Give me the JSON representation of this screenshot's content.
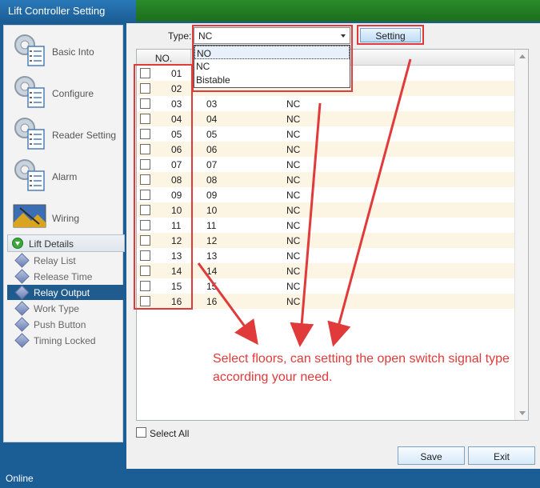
{
  "window": {
    "title": "Lift Controller Setting"
  },
  "sidebar": {
    "items": [
      {
        "label": "Basic Into",
        "icon": "gear-checklist-icon"
      },
      {
        "label": "Configure",
        "icon": "gear-checklist-icon"
      },
      {
        "label": "Reader Setting",
        "icon": "gear-checklist-icon"
      },
      {
        "label": "Alarm",
        "icon": "gear-checklist-icon"
      },
      {
        "label": "Wiring",
        "icon": "landscape-picture-icon"
      }
    ],
    "group": {
      "label": "Lift Details",
      "icon": "expand-toggle-icon",
      "items": [
        {
          "label": "Relay List",
          "active": false
        },
        {
          "label": "Release Time",
          "active": false
        },
        {
          "label": "Relay Output",
          "active": true
        },
        {
          "label": "Work Type",
          "active": false
        },
        {
          "label": "Push Button",
          "active": false
        },
        {
          "label": "Timing Locked",
          "active": false
        }
      ]
    }
  },
  "toolbar": {
    "type_label": "Type:",
    "type_value": "NC",
    "type_options": [
      "NO",
      "NC",
      "Bistable"
    ],
    "highlighted_option": "NO",
    "setting_label": "Setting"
  },
  "table": {
    "header_no": "NO.",
    "rows": [
      {
        "no": "01",
        "floor": "",
        "type": ""
      },
      {
        "no": "02",
        "floor": "",
        "type": ""
      },
      {
        "no": "03",
        "floor": "03",
        "type": "NC"
      },
      {
        "no": "04",
        "floor": "04",
        "type": "NC"
      },
      {
        "no": "05",
        "floor": "05",
        "type": "NC"
      },
      {
        "no": "06",
        "floor": "06",
        "type": "NC"
      },
      {
        "no": "07",
        "floor": "07",
        "type": "NC"
      },
      {
        "no": "08",
        "floor": "08",
        "type": "NC"
      },
      {
        "no": "09",
        "floor": "09",
        "type": "NC"
      },
      {
        "no": "10",
        "floor": "10",
        "type": "NC"
      },
      {
        "no": "11",
        "floor": "11",
        "type": "NC"
      },
      {
        "no": "12",
        "floor": "12",
        "type": "NC"
      },
      {
        "no": "13",
        "floor": "13",
        "type": "NC"
      },
      {
        "no": "14",
        "floor": "14",
        "type": "NC"
      },
      {
        "no": "15",
        "floor": "15",
        "type": "NC"
      },
      {
        "no": "16",
        "floor": "16",
        "type": "NC"
      }
    ]
  },
  "annotation": {
    "text": "Select floors, can setting the open switch signal type according your need.",
    "color": "#e03a3a"
  },
  "footer": {
    "select_all_label": "Select All",
    "save_label": "Save",
    "exit_label": "Exit"
  },
  "status": {
    "text": "Online"
  },
  "colors": {
    "accent_blue": "#1b5e95",
    "title_green": "#2a8c2a",
    "active_item": "#1f5b8c",
    "row_alt": "#fdf5e4"
  }
}
